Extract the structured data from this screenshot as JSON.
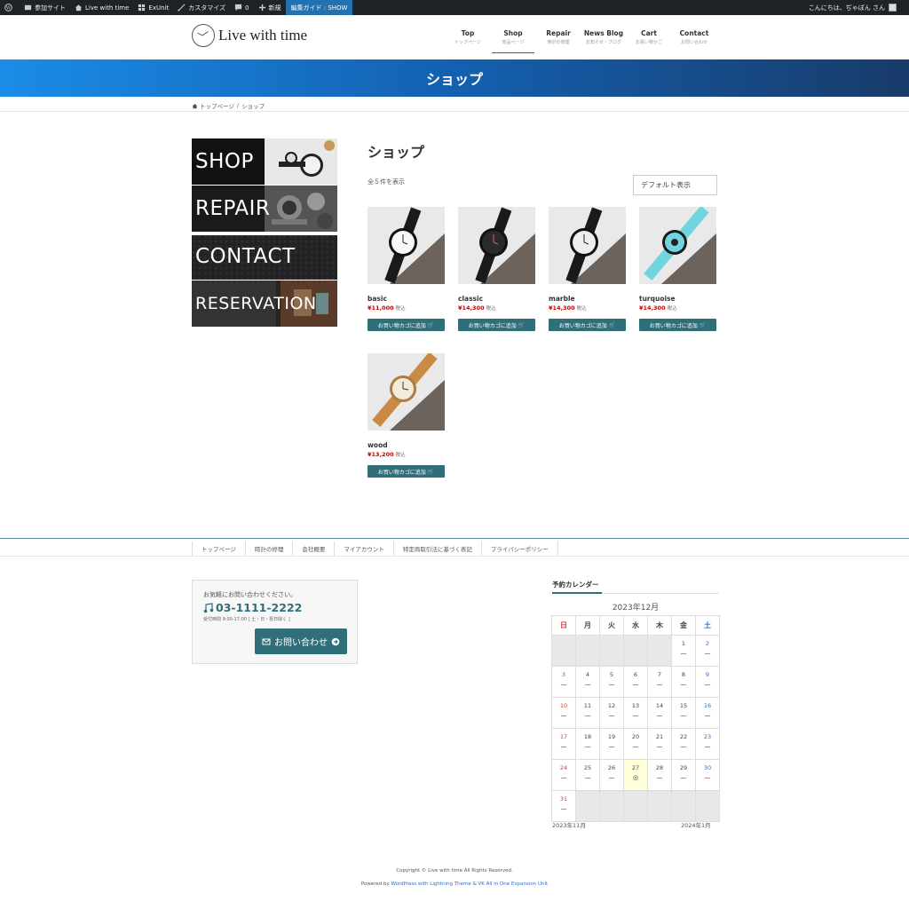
{
  "adminbar": {
    "items": [
      "参加サイト",
      "Live with time",
      "ExUnit",
      "カスタマイズ",
      "0",
      "新規"
    ],
    "guide": "編集ガイド : SHOW",
    "greeting": "こんにちは、ぢゃぽん さん"
  },
  "site": {
    "name": "Live with time"
  },
  "nav": [
    {
      "label": "Top",
      "sub": "トップページ"
    },
    {
      "label": "Shop",
      "sub": "商品ページ"
    },
    {
      "label": "Repair",
      "sub": "時計の修理"
    },
    {
      "label": "News Blog",
      "sub": "お知らせ・ブログ"
    },
    {
      "label": "Cart",
      "sub": "お買い物かご"
    },
    {
      "label": "Contact",
      "sub": "お問い合わせ"
    }
  ],
  "page": {
    "title": "ショップ",
    "heading": "ショップ",
    "count": "全５件を表示",
    "sort": "デフォルト表示"
  },
  "breadcrumb": {
    "home": "トップページ",
    "sep": "/",
    "current": "ショップ"
  },
  "sidebar": [
    "SHOP",
    "REPAIR",
    "CONTACT",
    "RESERVATION"
  ],
  "products": [
    {
      "name": "basic",
      "yen": "¥",
      "price": "11,000",
      "tax": "税込",
      "btn": "お買い物カゴに追加"
    },
    {
      "name": "classic",
      "yen": "¥",
      "price": "14,300",
      "tax": "税込",
      "btn": "お買い物カゴに追加"
    },
    {
      "name": "marble",
      "yen": "¥",
      "price": "14,300",
      "tax": "税込",
      "btn": "お買い物カゴに追加"
    },
    {
      "name": "turquoise",
      "yen": "¥",
      "price": "14,300",
      "tax": "税込",
      "btn": "お買い物カゴに追加"
    },
    {
      "name": "wood",
      "yen": "¥",
      "price": "13,200",
      "tax": "税込",
      "btn": "お買い物カゴに追加"
    }
  ],
  "footer_nav": [
    "トップページ",
    "時計の修理",
    "会社概要",
    "マイアカウント",
    "特定商取引法に基づく表記",
    "プライバシーポリシー"
  ],
  "contact": {
    "lead": "お気軽にお問い合わせください。",
    "tel": "03-1111-2222",
    "hours": "受付時間 9:00-17:00 [ 土・日・祝日除く ]",
    "button": "お問い合わせ"
  },
  "calendar": {
    "title": "予約カレンダー",
    "month": "2023年12月",
    "weekdays": [
      "日",
      "月",
      "火",
      "水",
      "木",
      "金",
      "土"
    ],
    "weeks": [
      [
        "",
        "",
        "",
        "",
        "",
        "1",
        "2"
      ],
      [
        "3",
        "4",
        "5",
        "6",
        "7",
        "8",
        "9"
      ],
      [
        "10",
        "11",
        "12",
        "13",
        "14",
        "15",
        "16"
      ],
      [
        "17",
        "18",
        "19",
        "20",
        "21",
        "22",
        "23"
      ],
      [
        "24",
        "25",
        "26",
        "27",
        "28",
        "29",
        "30"
      ],
      [
        "31",
        "",
        "",
        "",
        "",
        "",
        ""
      ]
    ],
    "status_closed": "—",
    "status_open": "◎",
    "today": "27",
    "prev": "2023年11月",
    "next": "2024年1月"
  },
  "footer": {
    "copyright": "Copyright © Live with time All Rights Reserved.",
    "powered_prefix": "Powered by",
    "powered_links": "WordPress with Lightning Theme & VK All in One Expansion Unit"
  },
  "colors": {
    "accent": "#2f6f7a",
    "banner_start": "#1a8ce8",
    "banner_end": "#183b6a",
    "price": "#cc0000"
  }
}
